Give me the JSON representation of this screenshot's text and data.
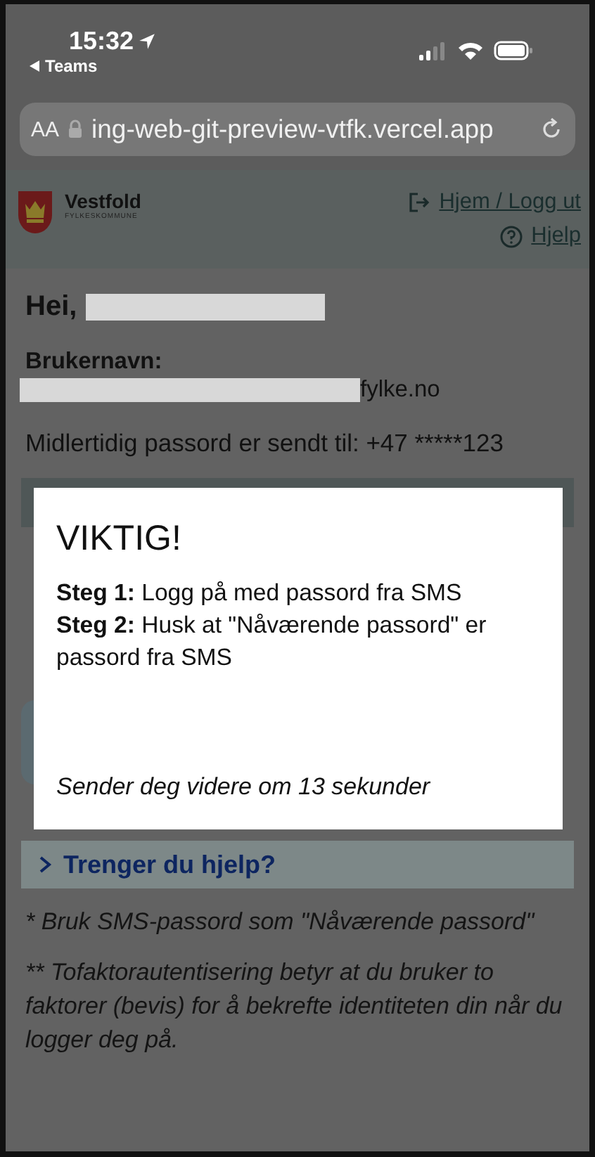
{
  "status_bar": {
    "time": "15:32",
    "back_label": "Teams"
  },
  "url_bar": {
    "text_size": "AA",
    "url": "ing-web-git-preview-vtfk.vercel.app"
  },
  "header": {
    "logo_name": "Vestfold",
    "logo_sub": "FYLKESKOMMUNE",
    "links": [
      {
        "label": "Hjem / Logg ut",
        "kind": "logout"
      },
      {
        "label": "Hjelp",
        "kind": "help"
      }
    ]
  },
  "greeting": "Hei,",
  "username_label": "Brukernavn:",
  "username_tail": "fylke.no",
  "sms_notice": "Midlertidig passord er sendt til: +47 *****123",
  "modal": {
    "title": "VIKTIG!",
    "steps": [
      "**Steg 1:** Logg på med passord fra SMS",
      "**Steg 2:** Husk at \"Nåværende passord\" er passord fra SMS"
    ],
    "countdown": "Sender deg videre om 13 sekunder"
  },
  "help_toggle": {
    "label": "Trenger du hjelp?",
    "expanded": false
  },
  "footnotes": [
    "* Bruk SMS-passord som \"Nåværende passord\"",
    "** Tofaktorautentisering betyr at du bruker to faktorer (bevis) for å bekrefte identiteten din når du logger deg på."
  ]
}
